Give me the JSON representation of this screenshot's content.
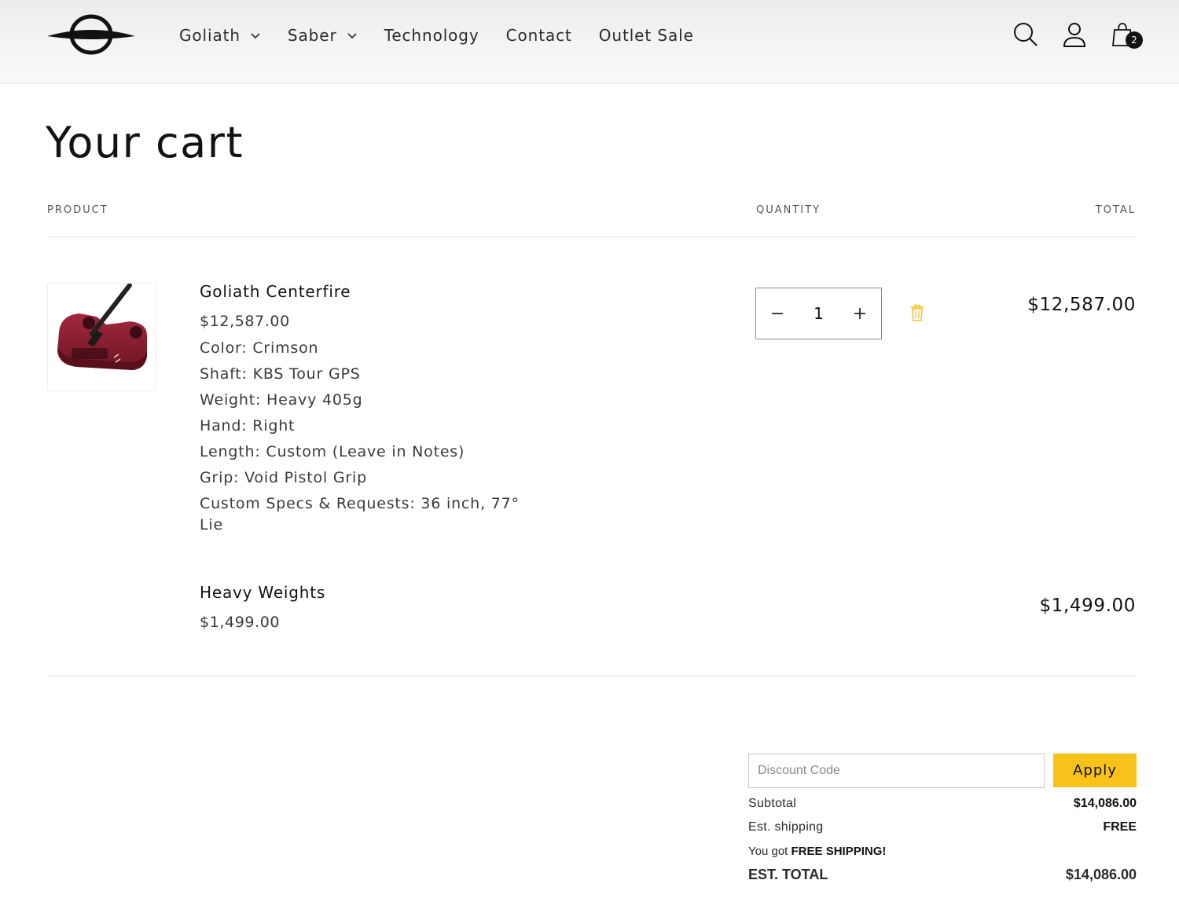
{
  "nav": {
    "items": [
      {
        "label": "Goliath",
        "has_dropdown": true
      },
      {
        "label": "Saber",
        "has_dropdown": true
      },
      {
        "label": "Technology",
        "has_dropdown": false
      },
      {
        "label": "Contact",
        "has_dropdown": false
      },
      {
        "label": "Outlet Sale",
        "has_dropdown": false
      }
    ],
    "icons": [
      "search-icon",
      "account-icon",
      "cart-icon"
    ],
    "cart_count": "2"
  },
  "page": {
    "title": "Your cart"
  },
  "table": {
    "headers": {
      "product": "PRODUCT",
      "quantity": "QUANTITY",
      "total": "TOTAL"
    }
  },
  "items": [
    {
      "name": "Goliath Centerfire",
      "price": "$12,587.00",
      "options": [
        "Color: Crimson",
        "Shaft: KBS Tour GPS",
        "Weight: Heavy 405g",
        "Hand: Right",
        "Length: Custom (Leave in Notes)",
        "Grip: Void Pistol Grip",
        "Custom Specs & Requests: 36 inch, 77° Lie"
      ],
      "quantity": "1",
      "line_total": "$12,587.00"
    },
    {
      "name": "Heavy Weights",
      "price": "$1,499.00",
      "line_total": "$1,499.00"
    }
  ],
  "summary": {
    "discount_placeholder": "Discount Code",
    "apply_label": "Apply",
    "subtotal_label": "Subtotal",
    "subtotal_value": "$14,086.00",
    "shipping_label": "Est. shipping",
    "shipping_value": "FREE",
    "free_ship_prefix": "You got",
    "free_ship_strong": "FREE SHIPPING!",
    "total_label": "EST. TOTAL",
    "total_value": "$14,086.00"
  },
  "colors": {
    "accent": "#f7c21a",
    "product": "#8e1f33",
    "text": "#121212"
  }
}
